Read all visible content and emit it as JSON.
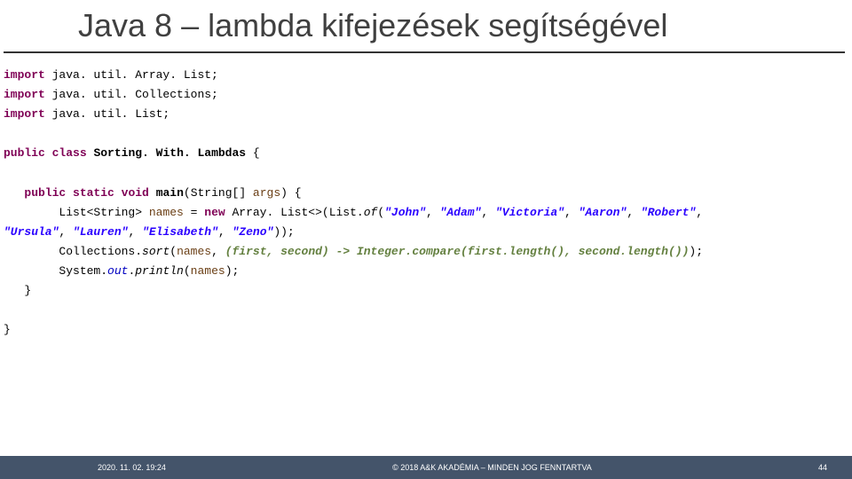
{
  "title": "Java 8 – lambda kifejezések segítségével",
  "imports": {
    "kw": "import",
    "l1": " java. util. Array. List;",
    "l2": " java. util. Collections;",
    "l3": " java. util. List;"
  },
  "cls": {
    "pub": "public",
    "cls": "class",
    "name": "Sorting. With. Lambdas ",
    "ob": "{"
  },
  "main": {
    "pub": "public",
    "stat": "static",
    "vd": "void",
    "name": "main",
    "sig1": "(String[] ",
    "arg": "args",
    "sig2": ") {"
  },
  "l_list": {
    "t1": "List<String> ",
    "v": "names",
    "eq": " = ",
    "nw": "new",
    "t2": " Array. List<>(List.",
    "of": "of",
    "op": "(",
    "s1": "\"John\"",
    "c": ", ",
    "s2": "\"Adam\"",
    "s3": "\"Victoria\"",
    "s4": "\"Aaron\"",
    "s5": "\"Robert\"",
    "s6": "\"Ursula\"",
    "s7": "\"Lauren\"",
    "s8": "\"Elisabeth\"",
    "s9": "\"Zeno\"",
    "cl": "));"
  },
  "l_sort": {
    "t": "Collections.",
    "m": "sort",
    "op": "(",
    "v": "names",
    "c": ", ",
    "lam": "(first, second) -> Integer.compare(first.length(), second.length())",
    "cl": ");"
  },
  "l_print": {
    "t1": "System.",
    "out": "out",
    "dot": ".",
    "pr": "println",
    "op": "(",
    "v": "names",
    "cl": ");"
  },
  "brace": "}",
  "footer": {
    "left": "2020. 11. 02. 19:24",
    "center": "© 2018 A&K AKADÉMIA – MINDEN JOG FENNTARTVA",
    "right": "44"
  }
}
